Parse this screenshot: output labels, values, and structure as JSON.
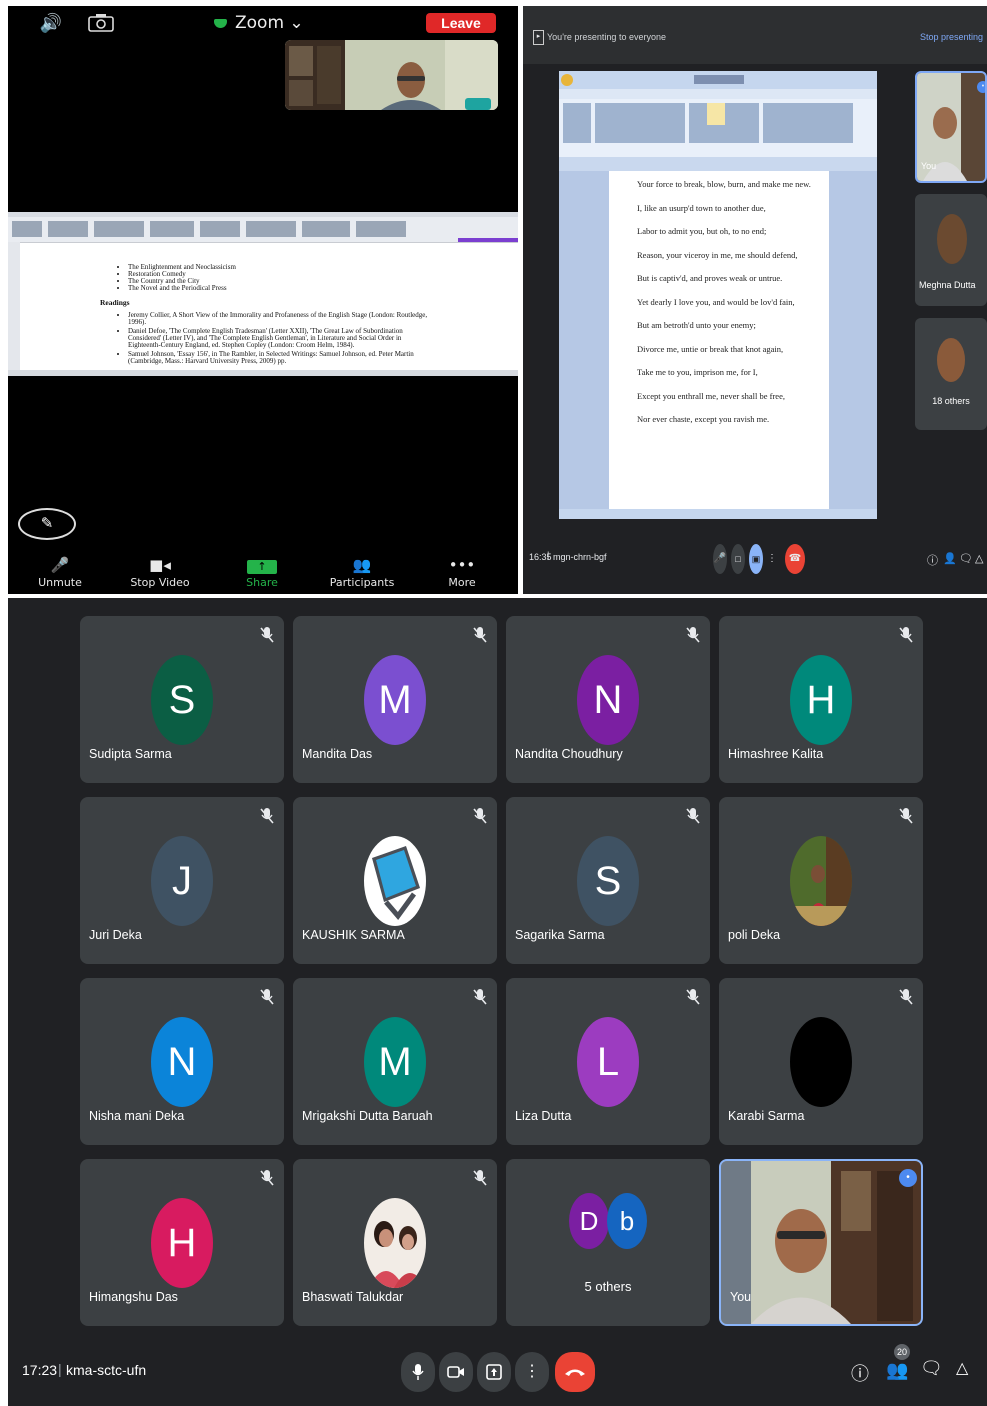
{
  "zoom": {
    "app_title": "Zoom",
    "leave_label": "Leave",
    "document": {
      "topics": [
        "The Enlightenment and Neoclassicism",
        "Restoration Comedy",
        "The Country and the City",
        "The Novel and the Periodical Press"
      ],
      "heading": "Readings",
      "readings": [
        "Jeremy Collier, A Short View of the Immorality and Profaneness of the English Stage (London: Routledge, 1996).",
        "Daniel Defoe, 'The Complete English Tradesman' (Letter XXII), 'The Great Law of Subordination Considered' (Letter IV), and 'The Complete English Gentleman', in Literature and Social Order in Eighteenth-Century England, ed. Stephen Copley (London: Croom Helm, 1984).",
        "Samuel Johnson, 'Essay 156', in The Rambler, in Selected Writings: Samuel Johnson, ed. Peter Martin (Cambridge, Mass.: Harvard University Press, 2009) pp."
      ]
    },
    "toolbar": [
      {
        "label": "Unmute",
        "icon": "mic-muted-icon"
      },
      {
        "label": "Stop Video",
        "icon": "video-icon"
      },
      {
        "label": "Share",
        "icon": "share-icon"
      },
      {
        "label": "Participants",
        "icon": "participants-icon"
      },
      {
        "label": "More",
        "icon": "more-icon"
      }
    ]
  },
  "meet_presenting": {
    "presenting_text": "You're presenting to everyone",
    "stop_label": "Stop presenting",
    "doc_lines": [
      "Your force to break, blow, burn, and make me new.",
      "I, like an usurp'd town to another due,",
      "Labor to admit you, but oh, to no end;",
      "Reason, your viceroy in me, me should defend,",
      "But is captiv'd, and proves weak or untrue.",
      "Yet dearly I love you, and would be lov'd fain,",
      "But am betroth'd unto your enemy;",
      "Divorce me, untie or break that knot again,",
      "Take me to you, imprison me, for I,",
      "Except you enthrall me, never shall be free,",
      "Nor ever chaste, except you ravish me."
    ],
    "side_tiles": {
      "self_label": "You",
      "person_label": "Meghna Dutta",
      "others_label": "18 others"
    },
    "time": "16:35",
    "code": "mgn-chrn-bgf"
  },
  "meet_grid": {
    "participants": [
      {
        "name": "Sudipta Sarma",
        "initial": "S",
        "color": "#0b5e44"
      },
      {
        "name": "Mandita Das",
        "initial": "M",
        "color": "#7b4fd0"
      },
      {
        "name": "Nandita Choudhury",
        "initial": "N",
        "color": "#7b1fa2"
      },
      {
        "name": "Himashree Kalita",
        "initial": "H",
        "color": "#00897b"
      },
      {
        "name": "Juri Deka",
        "initial": "J",
        "color": "#3f5263"
      },
      {
        "name": "KAUSHIK SARMA",
        "initial": "",
        "color": "#ffffff"
      },
      {
        "name": "Sagarika Sarma",
        "initial": "S",
        "color": "#3f5263"
      },
      {
        "name": "poli Deka",
        "initial": "",
        "color": "#7a5a3a"
      },
      {
        "name": "Nisha mani Deka",
        "initial": "N",
        "color": "#0b84d9"
      },
      {
        "name": "Mrigakshi Dutta Baruah",
        "initial": "M",
        "color": "#00897b"
      },
      {
        "name": "Liza Dutta",
        "initial": "L",
        "color": "#9c3cc0"
      },
      {
        "name": "Karabi Sarma",
        "initial": "",
        "color": "#000000"
      },
      {
        "name": "Himangshu Das",
        "initial": "H",
        "color": "#d81b60"
      },
      {
        "name": "Bhaswati Talukdar",
        "initial": "",
        "color": "#c9a59a"
      }
    ],
    "others_tile": {
      "label": "5 others",
      "initials": [
        "D",
        "b"
      ]
    },
    "self_label": "You",
    "time": "17:23",
    "code": "kma-sctc-ufn",
    "participant_count": "20"
  }
}
